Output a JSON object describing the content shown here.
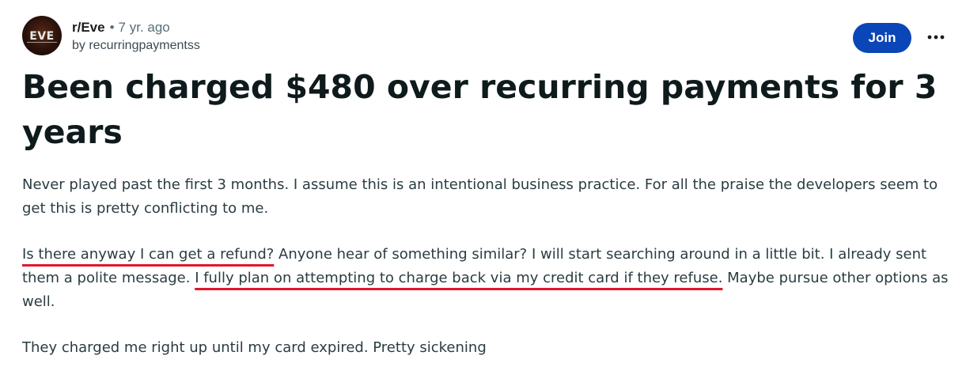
{
  "post": {
    "subreddit": "r/Eve",
    "separator": "•",
    "age": "7 yr. ago",
    "byline": "by recurringpaymentss",
    "avatar_icon": "eve-online-logo-icon",
    "avatar_text": "EVE",
    "join_label": "Join",
    "more_icon": "more-options-icon",
    "title": "Been charged $480 over recurring payments for 3 years",
    "paragraph1": "Never played past the first 3 months. I assume this is an intentional business practice. For all the praise the developers seem to get this is pretty conflicting to me.",
    "paragraph2": {
      "highlight1": "Is there anyway I can get a refund?",
      "text1": " Anyone hear of something similar? I will start searching around in a little bit. I already sent them a polite message. ",
      "highlight2": "I fully plan on attempting to charge back via my credit card if they refuse.",
      "text2": " Maybe pursue other options as well."
    },
    "paragraph3": "They charged me right up until my card expired. Pretty sickening"
  },
  "colors": {
    "join_button": "#0a46b8",
    "highlight_underline": "#e0162b",
    "avatar_background": "#2a120a"
  }
}
